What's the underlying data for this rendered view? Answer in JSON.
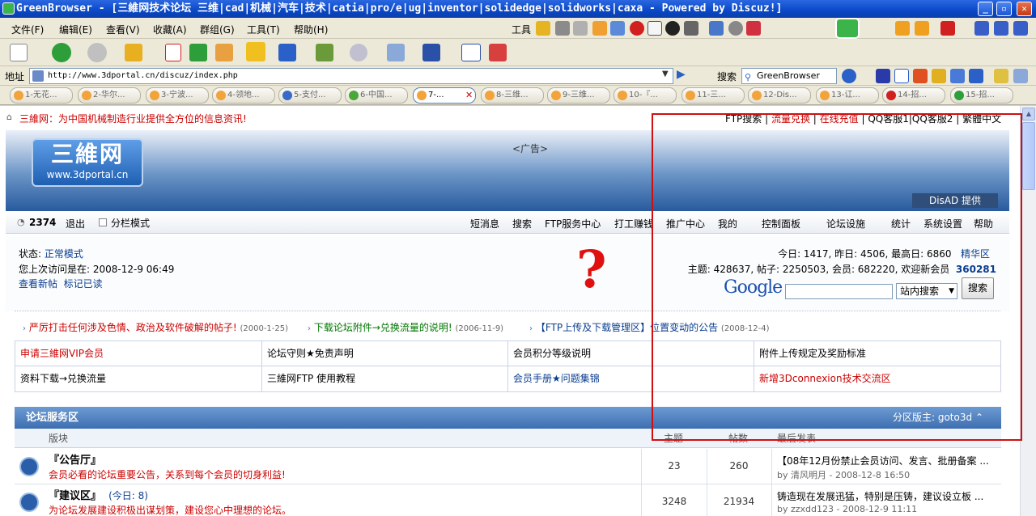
{
  "window": {
    "title": "GreenBrowser - [三維网技术论坛 三维|cad|机械|汽车|技术|catia|pro/e|ug|inventor|solidedge|solidworks|caxa - Powered by Discuz!]"
  },
  "menubar": {
    "items": [
      "文件(F)",
      "编辑(E)",
      "查看(V)",
      "收藏(A)",
      "群组(G)",
      "工具(T)",
      "帮助(H)"
    ],
    "tools_label": "工具"
  },
  "addressbar": {
    "label": "地址",
    "url": "http://www.3dportal.cn/discuz/index.php",
    "search_label": "搜索",
    "search_engine": "GreenBrowser"
  },
  "tabs": [
    {
      "label": "1-无花..."
    },
    {
      "label": "2-华尔..."
    },
    {
      "label": "3-宁波..."
    },
    {
      "label": "4-领地..."
    },
    {
      "label": "5-支付..."
    },
    {
      "label": "6-中国..."
    },
    {
      "label": "7-..."
    },
    {
      "label": "8-三维..."
    },
    {
      "label": "9-三维..."
    },
    {
      "label": "10-『..."
    },
    {
      "label": "11-三..."
    },
    {
      "label": "12-Dis..."
    },
    {
      "label": "13-讧..."
    },
    {
      "label": "14-招..."
    },
    {
      "label": "15-招..."
    }
  ],
  "page": {
    "slogan": "三維网：为中国机械制造行业提供全方位的信息资讯!",
    "toplinks": [
      "FTP搜索",
      "流量兑换",
      "在线充值",
      "QQ客服1",
      "QQ客服2",
      "繁體中文"
    ],
    "ad_label": "<广告>",
    "logo_big": "三維网",
    "logo_small": "www.3dportal.cn",
    "disad": "DisAD 提供",
    "user": {
      "name": "2374",
      "logout": "退出",
      "split_mode": "分栏模式"
    },
    "nav": [
      "短消息",
      "搜索",
      "FTP服务中心",
      "打工赚钱",
      "推广中心",
      "我的",
      "控制面板",
      "论坛设施",
      "统计",
      "系统设置",
      "帮助"
    ],
    "status": {
      "state_label": "状态:",
      "state_value": "正常模式",
      "last_visit": "您上次访问是在: 2008-12-9 06:49",
      "view_new": "查看新帖",
      "mark_read": "标记已读",
      "today_stats": "今日: 1417, 昨日: 4506, 最高日: 6860",
      "digest": "精华区",
      "totals": "主题: 428637, 帖子: 2250503, 会员: 682220, 欢迎新会员",
      "new_member": "360281"
    },
    "question_mark": "?",
    "google": {
      "logo": "Google",
      "select": "站内搜索",
      "button": "搜索"
    },
    "notices": [
      {
        "text": "严厉打击任何涉及色情、政治及软件破解的帖子!",
        "date": "(2000-1-25)"
      },
      {
        "text": "下载论坛附件→兑换流量的说明!",
        "date": "(2006-11-9)"
      },
      {
        "text": "【FTP上传及下载管理区】位置变动的公告",
        "date": "(2008-12-4)"
      }
    ],
    "links_grid": [
      [
        "申请三維网VIP会员",
        "论坛守则★免责声明",
        "会员积分等级说明",
        "附件上传规定及奖励标准"
      ],
      [
        "资料下载→兑换流量",
        "三維网FTP 使用教程",
        "会员手册★问题集锦",
        "新增3Dconnexion技术交流区"
      ]
    ],
    "section": {
      "title": "论坛服务区",
      "moderator": "分区版主: goto3d"
    },
    "table_headers": {
      "board": "版块",
      "topics": "主题",
      "posts": "帖数",
      "last": "最后发表"
    },
    "forums": [
      {
        "title": "『公告厅』",
        "today": "",
        "desc": "会员必看的论坛重要公告，关系到每个会员的切身利益!",
        "topics": "23",
        "posts": "260",
        "last_title": "【08年12月份禁止会员访问、发言、批册备案 ...",
        "last_by": "by 清风明月 - 2008-12-8 16:50"
      },
      {
        "title": "『建议区』",
        "today": "(今日: 8)",
        "desc": "为论坛发展建设积极出谋划策，建设您心中理想的论坛。",
        "topics": "3248",
        "posts": "21934",
        "last_title": "铸造现在发展迅猛，特别是压铸，建议设立板 ...",
        "last_by": "by zzxdd123 - 2008-12-9 11:11"
      }
    ]
  }
}
